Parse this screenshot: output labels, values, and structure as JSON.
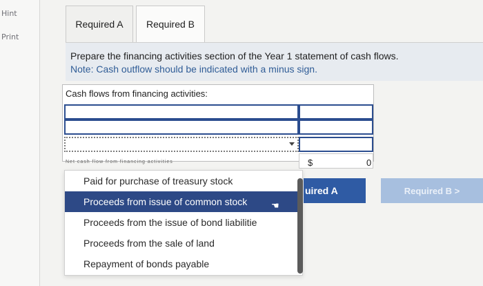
{
  "rail": {
    "hint": "Hint",
    "print": "Print"
  },
  "tabs": [
    {
      "label": "Required A"
    },
    {
      "label": "Required B"
    }
  ],
  "instructions": {
    "text": "Prepare the financing activities section of the Year 1 statement of cash flows.",
    "note": "Note: Cash outflow should be indicated with a minus sign."
  },
  "table": {
    "header": "Cash flows from financing activities:",
    "net_label_partial": "Net cash flow from financing activities",
    "currency": "$",
    "net_value": "0"
  },
  "dropdown": {
    "options": [
      "Paid for purchase of treasury stock",
      "Proceeds from issue of common stock",
      "Proceeds from the issue of bond liabilitie",
      "Proceeds from the sale of land",
      "Repayment of bonds payable"
    ],
    "selected_index": 1
  },
  "nav": {
    "prev_label": "uired A",
    "next_label": "Required B  >"
  },
  "colors": {
    "accent": "#2f5ba4",
    "selected": "#2d4986",
    "note": "#2f5c96"
  }
}
